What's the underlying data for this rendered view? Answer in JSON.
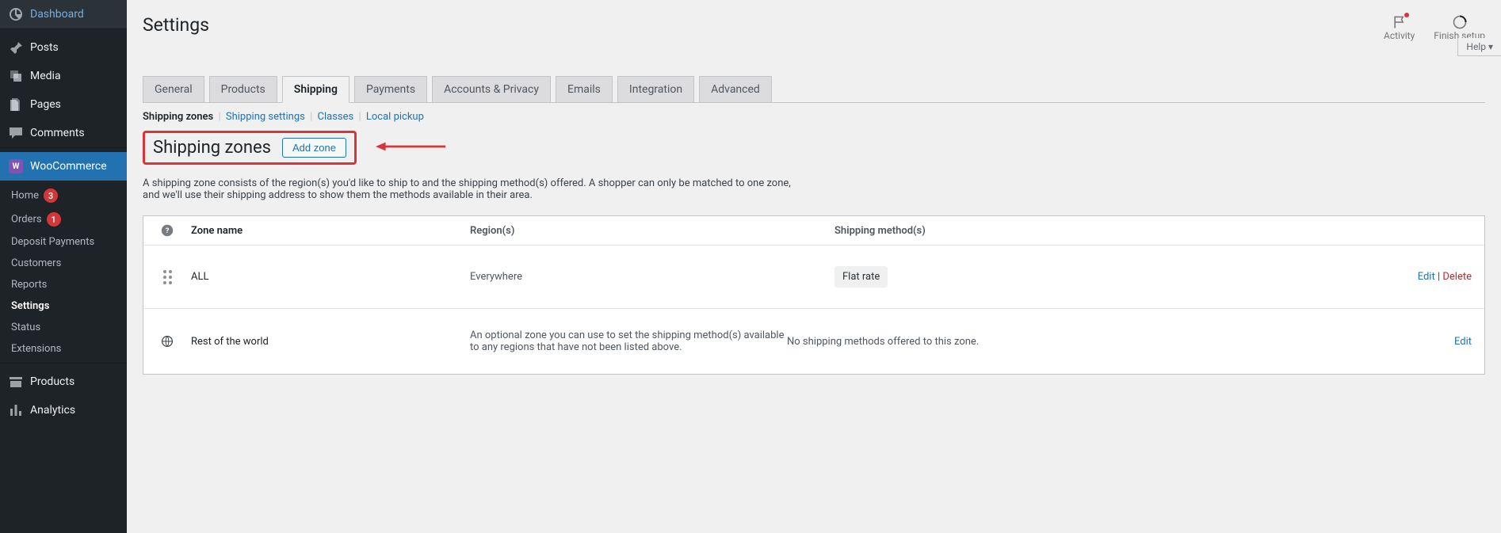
{
  "sidebar": {
    "items": [
      {
        "label": "Dashboard"
      },
      {
        "label": "Posts"
      },
      {
        "label": "Media"
      },
      {
        "label": "Pages"
      },
      {
        "label": "Comments"
      },
      {
        "label": "WooCommerce"
      },
      {
        "label": "Products"
      },
      {
        "label": "Analytics"
      }
    ],
    "woo_sub": [
      {
        "label": "Home",
        "badge": "3"
      },
      {
        "label": "Orders",
        "badge": "1"
      },
      {
        "label": "Deposit Payments"
      },
      {
        "label": "Customers"
      },
      {
        "label": "Reports"
      },
      {
        "label": "Settings"
      },
      {
        "label": "Status"
      },
      {
        "label": "Extensions"
      }
    ]
  },
  "header": {
    "title": "Settings",
    "activity": "Activity",
    "finish": "Finish setup",
    "help": "Help"
  },
  "tabs": [
    "General",
    "Products",
    "Shipping",
    "Payments",
    "Accounts & Privacy",
    "Emails",
    "Integration",
    "Advanced"
  ],
  "active_tab_index": 2,
  "sublinks": [
    "Shipping zones",
    "Shipping settings",
    "Classes",
    "Local pickup"
  ],
  "heading": "Shipping zones",
  "add_zone": "Add zone",
  "desc": "A shipping zone consists of the region(s) you'd like to ship to and the shipping method(s) offered. A shopper can only be matched to one zone, and we'll use their shipping address to show them the methods available in their area.",
  "table": {
    "cols": [
      "Zone name",
      "Region(s)",
      "Shipping method(s)"
    ],
    "rows": [
      {
        "name": "ALL",
        "region": "Everywhere",
        "method": "Flat rate",
        "edit": "Edit",
        "delete": "Delete"
      },
      {
        "name": "Rest of the world",
        "region": "An optional zone you can use to set the shipping method(s) available to any regions that have not been listed above.",
        "method": "No shipping methods offered to this zone.",
        "edit": "Edit"
      }
    ]
  }
}
